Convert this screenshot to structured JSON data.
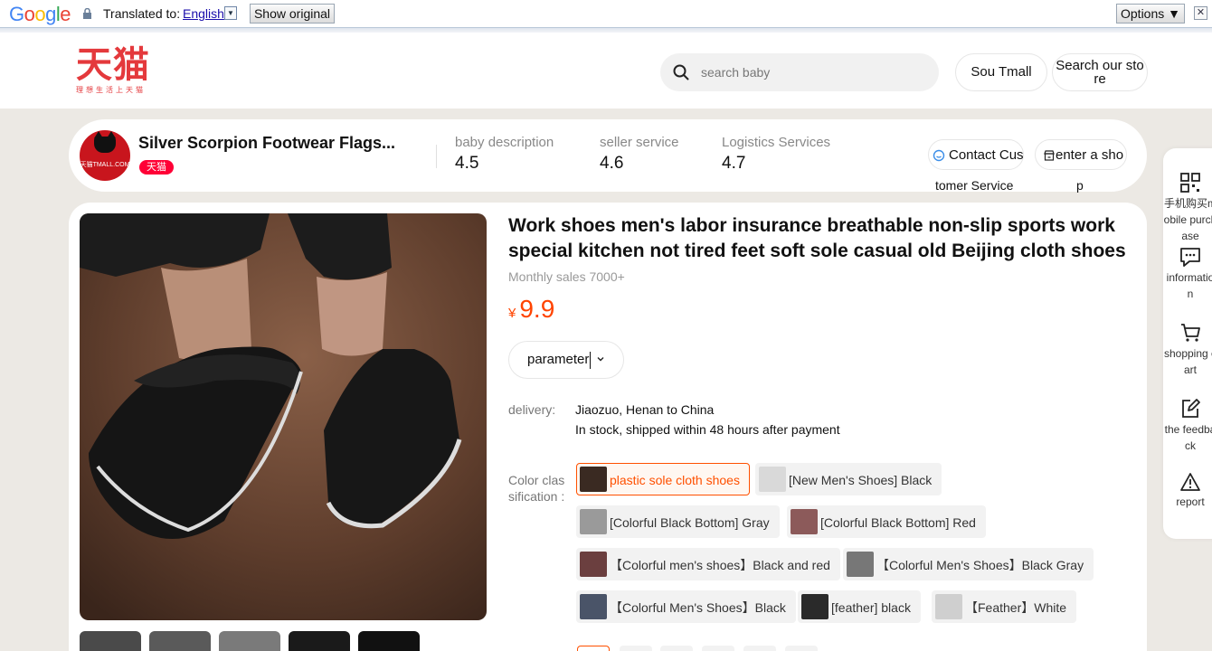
{
  "translate_bar": {
    "translated_to_label": "Translated to:",
    "language": "English",
    "show_original_label": "Show original",
    "options_label": "Options ▼",
    "close_label": "✕",
    "colors": {
      "brand_blue": "#4285f4",
      "brand_red": "#ea4335",
      "brand_yellow": "#fbbc05",
      "brand_green": "#34a853"
    }
  },
  "header": {
    "logo_text": "天猫",
    "logo_tagline": "理想生活上天猫",
    "search_placeholder": "search baby",
    "sou_tmall_label": "Sou Tmall",
    "search_store_label": "Search our sto re"
  },
  "store": {
    "name": "Silver Scorpion Footwear Flags...",
    "badge": "天猫",
    "avatar_text": "天猫TMALL.COM",
    "scores": [
      {
        "label": "baby description",
        "value": "4.5"
      },
      {
        "label": "seller service",
        "value": "4.6"
      },
      {
        "label": "Logistics Services",
        "value": "4.7"
      }
    ],
    "contact_label_1": "Contact Cus",
    "contact_label_2": "tomer Service",
    "enter_label_1": "enter a sho",
    "enter_label_2": "p"
  },
  "product": {
    "title": "Work shoes men's labor insurance breathable non-slip sports work special kitchen not tired feet soft sole casual old Beijing cloth shoes",
    "monthly_sales": "Monthly sales 7000+",
    "currency": "¥",
    "price": "9.9",
    "parameter_label": "parameter",
    "delivery_label": "delivery:",
    "delivery_route": "Jiaozuo, Henan to China",
    "delivery_note": "In stock, shipped within 48 hours after payment",
    "color_label": "Color clas sification :",
    "accent_color": "#ff5000",
    "variants": [
      {
        "label": "plastic sole cloth shoes",
        "selected": true
      },
      {
        "label": "[New Men's Shoes] Black",
        "selected": false
      },
      {
        "label": "[Colorful Black Bottom] Gray",
        "selected": false
      },
      {
        "label": "[Colorful Black Bottom] Red",
        "selected": false
      },
      {
        "label": "【Colorful men's shoes】Black and red",
        "selected": false
      },
      {
        "label": "【Colorful Men's Shoes】Black Gray",
        "selected": false
      },
      {
        "label": "【Colorful Men's Shoes】Black",
        "selected": false
      },
      {
        "label": "[feather] black",
        "selected": false
      },
      {
        "label": "【Feather】White",
        "selected": false
      }
    ]
  },
  "sidebar": {
    "items": [
      {
        "label": "手机购买m obile purch ase",
        "icon": "qr-code-icon"
      },
      {
        "label": "informatio n",
        "icon": "chat-bubble-icon"
      },
      {
        "label": "shopping c art",
        "icon": "cart-icon"
      },
      {
        "label": "the feedba ck",
        "icon": "edit-icon"
      },
      {
        "label": "report",
        "icon": "warning-icon"
      }
    ]
  }
}
